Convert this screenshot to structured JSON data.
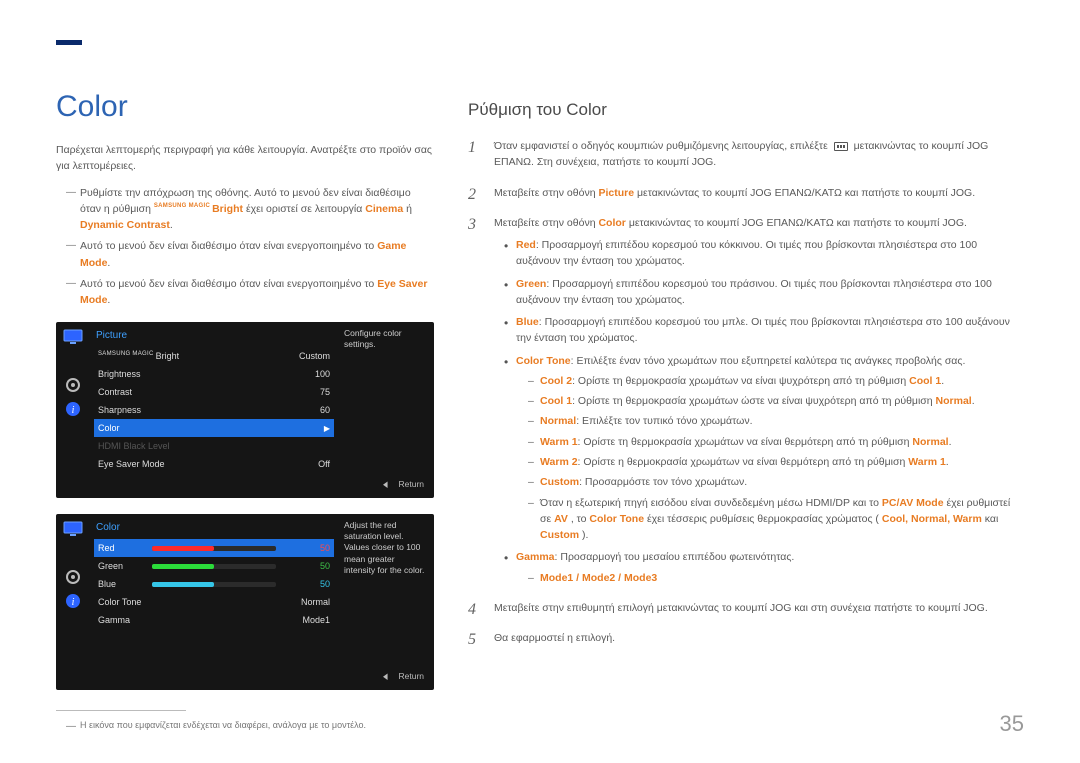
{
  "left": {
    "heading": "Color",
    "intro": "Παρέχεται λεπτομερής περιγραφή για κάθε λειτουργία. Ανατρέξτε στο προϊόν σας για λεπτομέρειες.",
    "note1_pre": "Ρυθμίστε την απόχρωση της οθόνης. Αυτό το μενού δεν είναι διαθέσιμο όταν η ρύθμιση ",
    "note1_magic_prefix": "SAMSUNG MAGIC",
    "note1_bright": "Bright",
    "note1_mid": " έχει οριστεί σε λειτουργία ",
    "note1_cinema": "Cinema",
    "note1_or": " ή ",
    "note1_dyn": "Dynamic Contrast",
    "note1_end": ".",
    "note2_pre": "Αυτό το μενού δεν είναι διαθέσιμο όταν είναι ενεργοποιημένο το ",
    "note2_em": "Game Mode",
    "note2_end": ".",
    "note3_pre": "Αυτό το μενού δεν είναι διαθέσιμο όταν είναι ενεργοποιημένο το ",
    "note3_em": "Eye Saver Mode",
    "note3_end": ".",
    "footnote": "Η εικόνα που εμφανίζεται ενδέχεται να διαφέρει, ανάλογα με το μοντέλο."
  },
  "osd1": {
    "title": "Picture",
    "tip": "Configure color settings.",
    "rows": {
      "magic_prefix": "SAMSUNG MAGIC",
      "magic_label": "Bright",
      "magic_val": "Custom",
      "brightness_label": "Brightness",
      "brightness_val": "100",
      "contrast_label": "Contrast",
      "contrast_val": "75",
      "sharpness_label": "Sharpness",
      "sharpness_val": "60",
      "color_label": "Color",
      "hdmi_label": "HDMI Black Level",
      "eye_label": "Eye Saver Mode",
      "eye_val": "Off"
    },
    "return": "Return"
  },
  "osd2": {
    "title": "Color",
    "tip": "Adjust the red saturation level. Values closer to 100 mean greater intensity for the color.",
    "rows": {
      "red_label": "Red",
      "red_val": "50",
      "green_label": "Green",
      "green_val": "50",
      "blue_label": "Blue",
      "blue_val": "50",
      "tone_label": "Color Tone",
      "tone_val": "Normal",
      "gamma_label": "Gamma",
      "gamma_val": "Mode1"
    },
    "return": "Return"
  },
  "right": {
    "heading": "Ρύθμιση του Color",
    "s1a": "Όταν εμφανιστεί ο οδηγός κουμπιών ρυθμιζόμενης λειτουργίας, επιλέξτε ",
    "s1b": " μετακινώντας το κουμπί JOG ΕΠΑΝΩ. Στη συνέχεια, πατήστε το κουμπί JOG.",
    "s2a": "Μεταβείτε στην οθόνη ",
    "s2em": "Picture",
    "s2b": " μετακινώντας το κουμπί JOG ΕΠΑΝΩ/ΚΑΤΩ και πατήστε το κουμπί JOG.",
    "s3a": "Μεταβείτε στην οθόνη ",
    "s3em": "Color",
    "s3b": " μετακινώντας το κουμπί JOG ΕΠΑΝΩ/ΚΑΤΩ και πατήστε το κουμπί JOG.",
    "bul": {
      "red_em": "Red",
      "red": ": Προσαρμογή επιπέδου κορεσμού του κόκκινου. Οι τιμές που βρίσκονται πλησιέστερα στο 100 αυξάνουν την ένταση του χρώματος.",
      "green_em": "Green",
      "green": ": Προσαρμογή επιπέδου κορεσμού του πράσινου. Οι τιμές που βρίσκονται πλησιέστερα στο 100 αυξάνουν την ένταση του χρώματος.",
      "blue_em": "Blue",
      "blue": ": Προσαρμογή επιπέδου κορεσμού του μπλε. Οι τιμές που βρίσκονται πλησιέστερα στο 100 αυξάνουν την ένταση του χρώματος.",
      "ctone_em": "Color Tone",
      "ctone": ": Επιλέξτε έναν τόνο χρωμάτων που εξυπηρετεί καλύτερα τις ανάγκες προβολής σας.",
      "cool2_em": "Cool 2",
      "cool2a": ": Ορίστε τη θερμοκρασία χρωμάτων να είναι ψυχρότερη από τη ρύθμιση ",
      "cool2b": "Cool 1",
      "cool1_em": "Cool 1",
      "cool1a": ": Ορίστε τη θερμοκρασία χρωμάτων ώστε να είναι ψυχρότερη από τη ρύθμιση ",
      "cool1b": "Normal",
      "normal_em": "Normal",
      "normal": ": Επιλέξτε τον τυπικό τόνο χρωμάτων.",
      "warm1_em": "Warm 1",
      "warm1a": ": Ορίστε τη θερμοκρασία χρωμάτων να είναι θερμότερη από τη ρύθμιση ",
      "warm1b": "Normal",
      "warm2_em": "Warm 2",
      "warm2a": ": Ορίστε η θερμοκρασία χρωμάτων να είναι θερμότερη από τη ρύθμιση ",
      "warm2b": "Warm 1",
      "custom_em": "Custom",
      "custom": ": Προσαρμόστε τον τόνο χρωμάτων.",
      "pcav_a": "Όταν η εξωτερική πηγή εισόδου είναι συνδεδεμένη μέσω HDMI/DP και το ",
      "pcav_em1": "PC/AV Mode",
      "pcav_b": " έχει ρυθμιστεί σε ",
      "pcav_em2": "AV",
      "pcav_c": ", το ",
      "pcav_em3": "Color Tone",
      "pcav_d": " έχει τέσσερις ρυθμίσεις θερμοκρασίας χρώματος (",
      "pcav_list": "Cool, Normal, Warm",
      "pcav_and": " και ",
      "pcav_last": "Custom",
      "pcav_e": ").",
      "gamma_em": "Gamma",
      "gamma": ": Προσαρμογή του μεσαίου επιπέδου φωτεινότητας.",
      "modes": "Mode1 / Mode2 / Mode3"
    },
    "s4": "Μεταβείτε στην επιθυμητή επιλογή μετακινώντας το κουμπί JOG και στη συνέχεια πατήστε το κουμπί JOG.",
    "s5": "Θα εφαρμοστεί η επιλογή."
  },
  "page_number": "35"
}
